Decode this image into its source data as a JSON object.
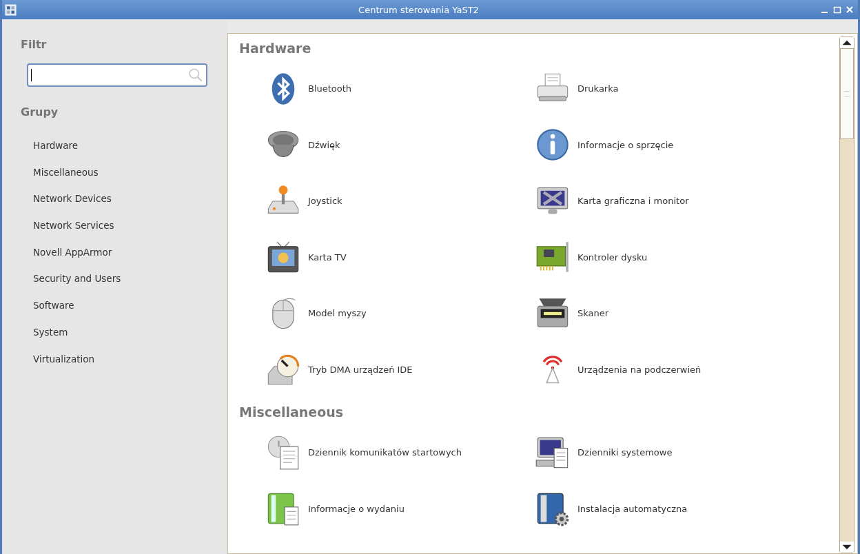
{
  "window": {
    "title": "Centrum sterowania YaST2"
  },
  "sidebar": {
    "filter_label": "Filtr",
    "search_field": {
      "focused": true
    },
    "groups_label": "Grupy",
    "items": [
      {
        "label": "Hardware"
      },
      {
        "label": "Miscellaneous"
      },
      {
        "label": "Network Devices"
      },
      {
        "label": "Network Services"
      },
      {
        "label": "Novell AppArmor"
      },
      {
        "label": "Security and Users"
      },
      {
        "label": "Software"
      },
      {
        "label": "System"
      },
      {
        "label": "Virtualization"
      }
    ]
  },
  "sections": [
    {
      "title": "Hardware",
      "modules": [
        {
          "label": "Bluetooth"
        },
        {
          "label": "Drukarka"
        },
        {
          "label": "Dźwięk"
        },
        {
          "label": "Informacje o sprzęcie"
        },
        {
          "label": "Joystick"
        },
        {
          "label": "Karta graficzna i monitor"
        },
        {
          "label": "Karta TV"
        },
        {
          "label": "Kontroler dysku"
        },
        {
          "label": "Model myszy"
        },
        {
          "label": "Skaner"
        },
        {
          "label": "Tryb DMA urządzeń IDE"
        },
        {
          "label": "Urządzenia na podczerwień"
        }
      ]
    },
    {
      "title": "Miscellaneous",
      "modules": [
        {
          "label": "Dziennik komunikatów startowych"
        },
        {
          "label": "Dzienniki systemowe"
        },
        {
          "label": "Informacje o wydaniu"
        },
        {
          "label": "Instalacja automatyczna"
        }
      ]
    }
  ]
}
